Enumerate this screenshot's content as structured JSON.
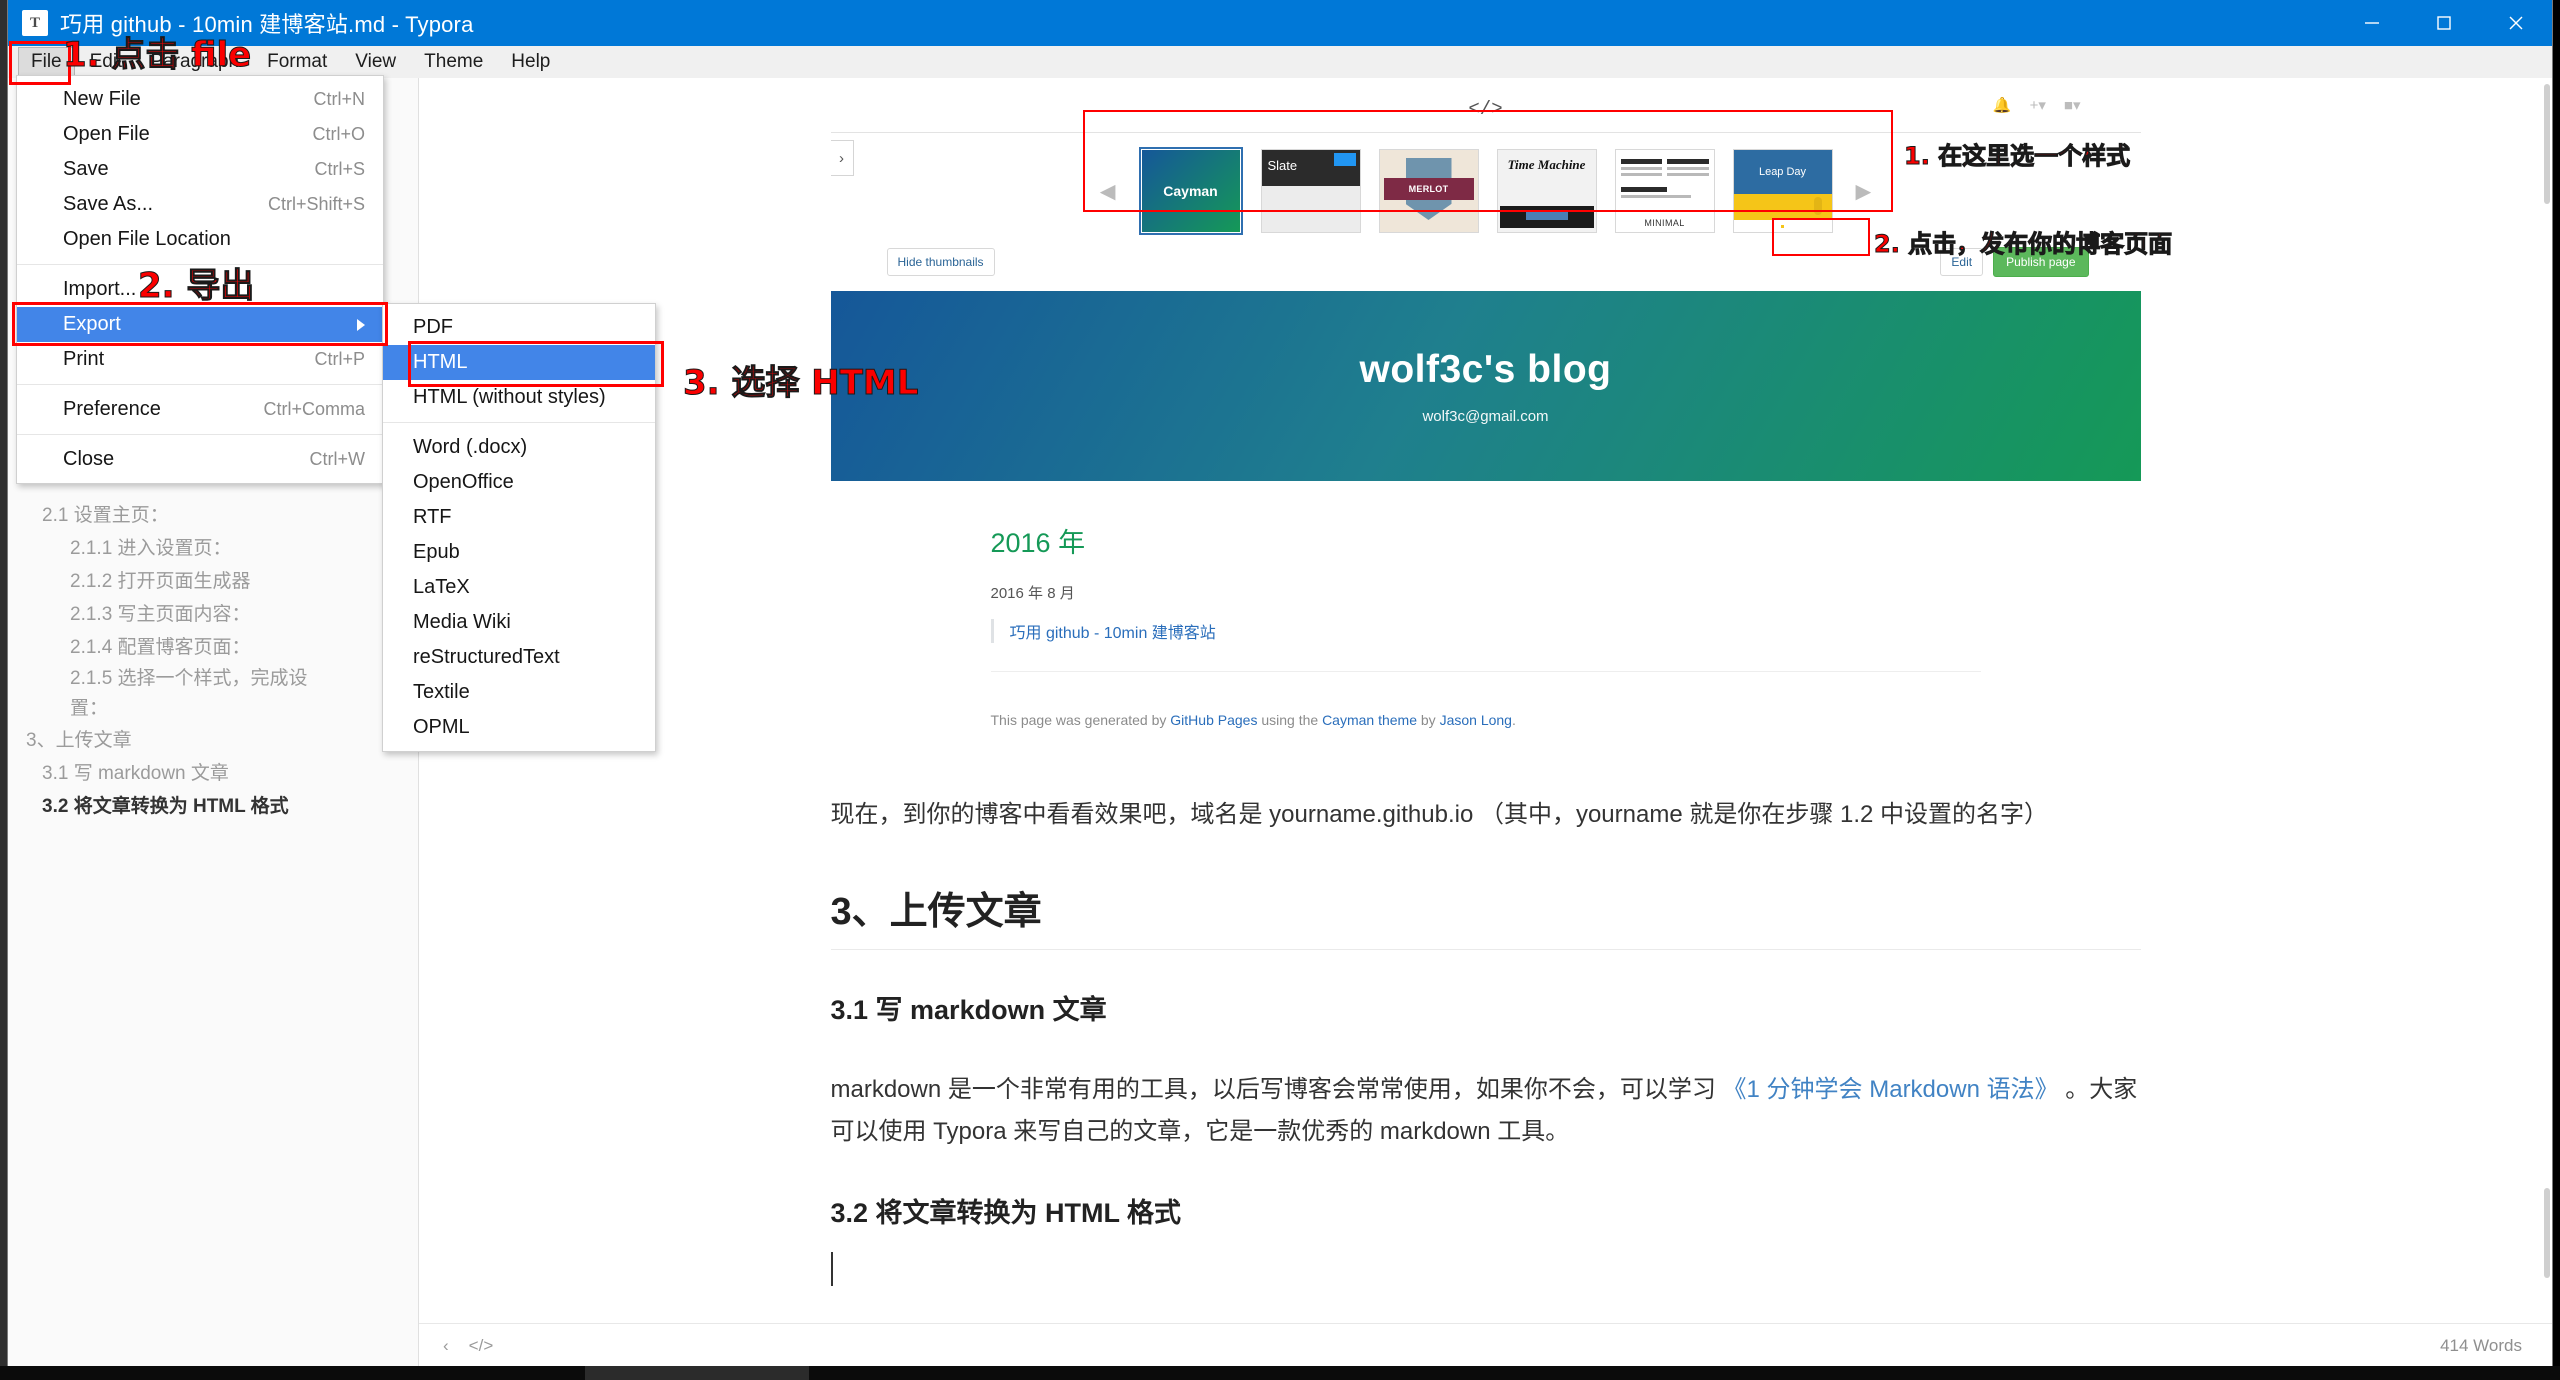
{
  "window": {
    "title": "巧用 github - 10min 建博客站.md - Typora",
    "app_icon": "T",
    "minimize": "minimize-icon",
    "maximize": "maximize-icon",
    "close": "close-icon"
  },
  "menubar": {
    "items": [
      {
        "label": "File",
        "active": true
      },
      {
        "label": "Edit",
        "active": false
      },
      {
        "label": "Paragraph",
        "active": false
      },
      {
        "label": "Format",
        "active": false
      },
      {
        "label": "View",
        "active": false
      },
      {
        "label": "Theme",
        "active": false
      },
      {
        "label": "Help",
        "active": false
      }
    ]
  },
  "file_menu": {
    "items": [
      {
        "label": "New File",
        "shortcut": "Ctrl+N"
      },
      {
        "label": "Open File",
        "shortcut": "Ctrl+O"
      },
      {
        "label": "Save",
        "shortcut": "Ctrl+S"
      },
      {
        "label": "Save As...",
        "shortcut": "Ctrl+Shift+S"
      },
      {
        "label": "Open File Location",
        "shortcut": ""
      },
      {
        "label": "Import...",
        "shortcut": ""
      },
      {
        "label": "Export",
        "shortcut": "",
        "highlighted": true,
        "has_submenu": true
      },
      {
        "label": "Print",
        "shortcut": "Ctrl+P"
      },
      {
        "label": "Preference",
        "shortcut": "Ctrl+Comma"
      },
      {
        "label": "Close",
        "shortcut": "Ctrl+W"
      }
    ]
  },
  "export_submenu": {
    "items": [
      {
        "label": "PDF",
        "highlighted": false
      },
      {
        "label": "HTML",
        "highlighted": true
      },
      {
        "label": "HTML (without styles)",
        "highlighted": false
      },
      {
        "label": "Word (.docx)",
        "highlighted": false
      },
      {
        "label": "OpenOffice",
        "highlighted": false
      },
      {
        "label": "RTF",
        "highlighted": false
      },
      {
        "label": "Epub",
        "highlighted": false
      },
      {
        "label": "LaTeX",
        "highlighted": false
      },
      {
        "label": "Media Wiki",
        "highlighted": false
      },
      {
        "label": "reStructuredText",
        "highlighted": false
      },
      {
        "label": "Textile",
        "highlighted": false
      },
      {
        "label": "OPML",
        "highlighted": false
      }
    ]
  },
  "outline": {
    "items": [
      {
        "label": "2.1 设置主页：",
        "level": 1
      },
      {
        "label": "2.1.1 进入设置页：",
        "level": 2
      },
      {
        "label": "2.1.2 打开页面生成器",
        "level": 2
      },
      {
        "label": "2.1.3 写主页面内容：",
        "level": 2
      },
      {
        "label": "2.1.4 配置博客页面：",
        "level": 2
      },
      {
        "label": "2.1.5 选择一个样式，完成设置：",
        "level": 2
      },
      {
        "label": "3、上传文章",
        "level": 0
      },
      {
        "label": "3.1 写 markdown 文章",
        "level": 1
      },
      {
        "label": "3.2 将文章转换为 HTML 格式",
        "level": 1,
        "current": true
      }
    ]
  },
  "embedded_shot": {
    "code_icon": "code-icon",
    "themes": [
      {
        "name": "Cayman",
        "selected": true
      },
      {
        "name": "Slate",
        "selected": false
      },
      {
        "name": "MERLOT",
        "selected": false
      },
      {
        "name": "Time Machine",
        "selected": false
      },
      {
        "name": "MINIMAL",
        "selected": false
      },
      {
        "name": "Leap Day",
        "selected": false
      }
    ],
    "prev_arrow": "◄",
    "next_arrow": "►",
    "hide_thumbnails": "Hide thumbnails",
    "edit_button": "Edit",
    "publish_button": "Publish page",
    "banner_title": "wolf3c's blog",
    "banner_email": "wolf3c@gmail.com",
    "year": "2016 年",
    "month": "2016 年 8 月",
    "post_link": "巧用 github - 10min 建博客站",
    "footer_prefix": "This page was generated by ",
    "footer_link1": "GitHub Pages",
    "footer_mid": " using the ",
    "footer_link2": "Cayman theme",
    "footer_by": " by ",
    "footer_link3": "Jason Long",
    "footer_end": "."
  },
  "document": {
    "para1": "现在，到你的博客中看看效果吧，域名是 yourname.github.io （其中，yourname 就是你在步骤 1.2 中设置的名字）",
    "h2": "3、上传文章",
    "h3_1": "3.1 写 markdown 文章",
    "para2_a": "markdown 是一个非常有用的工具，以后写博客会常常使用，如果你不会，可以学习 ",
    "para2_link": "《1 分钟学会 Markdown 语法》",
    "para2_b": " 。大家可以使用 Typora 来写自己的文章，它是一款优秀的 markdown 工具。",
    "h3_2": "3.2 将文章转换为 HTML 格式"
  },
  "statusbar": {
    "back_icon": "chevron-left-icon",
    "source_icon": "source-code-icon",
    "word_count": "414 Words"
  },
  "annotations": [
    {
      "id": "a1",
      "text": "1. 点击 file"
    },
    {
      "id": "a2",
      "text": "2. 导出"
    },
    {
      "id": "a3",
      "text": "3. 选择 HTML"
    },
    {
      "id": "a4",
      "text": "1. 在这里选一个样式"
    },
    {
      "id": "a5",
      "text": "2. 点击，发布你的博客页面"
    }
  ],
  "colors": {
    "titlebar": "#0078d7",
    "menu_highlight": "#4285e8",
    "annotation_red": "#fb0000",
    "publish_green": "#5cb85c",
    "cayman_gradient_start": "#155799",
    "cayman_gradient_end": "#159957"
  }
}
